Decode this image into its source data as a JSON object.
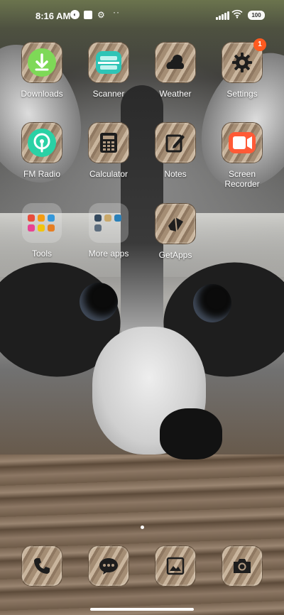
{
  "status_bar": {
    "time": "8:16 AM",
    "battery": "100",
    "more": "··"
  },
  "apps": [
    {
      "label": "Downloads",
      "icon": "download-icon",
      "color": "#7ed957"
    },
    {
      "label": "Scanner",
      "icon": "scanner-icon",
      "color": "#2ec4b6"
    },
    {
      "label": "Weather",
      "icon": "weather-icon",
      "color": "#222222"
    },
    {
      "label": "Settings",
      "icon": "gear-icon",
      "color": "#222222",
      "badge": "1"
    },
    {
      "label": "FM Radio",
      "icon": "radio-icon",
      "color": "#2ad1a5"
    },
    {
      "label": "Calculator",
      "icon": "calculator-icon",
      "color": "#222222"
    },
    {
      "label": "Notes",
      "icon": "notes-icon",
      "color": "#222222"
    },
    {
      "label": "Screen\nRecorder",
      "label_line1": "Screen",
      "label_line2": "Recorder",
      "icon": "screen-recorder-icon",
      "color": "#ff5a36"
    },
    {
      "label": "Tools",
      "icon": "folder-icon"
    },
    {
      "label": "More apps",
      "icon": "folder-icon"
    },
    {
      "label": "GetApps",
      "icon": "getapps-icon",
      "color": "#222222"
    }
  ],
  "dock": [
    {
      "icon": "phone-icon"
    },
    {
      "icon": "messages-icon"
    },
    {
      "icon": "gallery-icon"
    },
    {
      "icon": "camera-icon"
    }
  ],
  "colors": {
    "badge": "#ff5a1f",
    "tile_wood": "#b29b82"
  }
}
